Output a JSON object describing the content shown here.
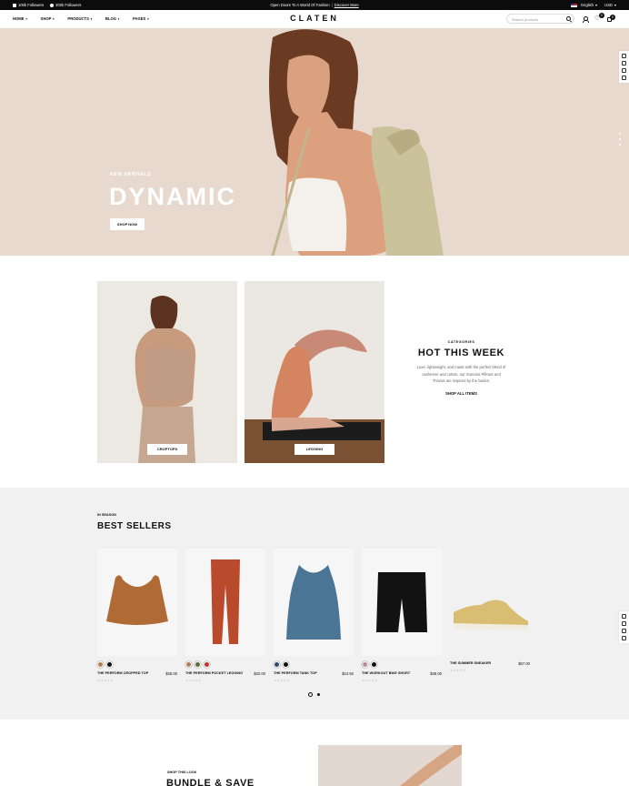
{
  "topbar": {
    "instagram_followers": "100k Followers",
    "facebook_followers": "300k Followers",
    "promo": "Open Doors To A World Of Fashion",
    "promo_link": "Discover More",
    "language": "English",
    "currency": "USD"
  },
  "header": {
    "logo": "CLATEN",
    "nav": [
      "HOME",
      "SHOP",
      "PRODUCTS",
      "BLOG",
      "PAGES"
    ],
    "search_placeholder": "Search products",
    "wishlist_count": "0",
    "cart_count": "0"
  },
  "hero": {
    "eyebrow": "NEW ARRIVALS",
    "title": "DYNAMIC",
    "button": "SHOP NOW"
  },
  "categories": {
    "cards": [
      "CROPTOPS",
      "LEGGING"
    ],
    "eyebrow": "CATEGORIES",
    "title": "HOT THIS WEEK",
    "description": "Luxe, lightweight, and made with the perfect blend of cashmere and cotton, our Sonoma Pillows and Throws are inspired by the basics.",
    "link": "SHOP ALL ITEMS"
  },
  "best_sellers": {
    "eyebrow": "IN SEASON",
    "title": "BEST SELLERS",
    "products": [
      {
        "name": "THE PERFORM CROPPED TOP",
        "price": "$35.00",
        "swatches": [
          "#b77a54",
          "#111111"
        ]
      },
      {
        "name": "THE PERFORM POCKET LEGGING",
        "price": "$32.00",
        "swatches": [
          "#b77a54",
          "#5d6a3a",
          "#c8302c"
        ]
      },
      {
        "name": "THE PERFORM TANK TOP",
        "price": "$24.50",
        "swatches": [
          "#2f4a6b",
          "#111111"
        ]
      },
      {
        "name": "THE WORKOUT BIKE SHORT",
        "price": "$38.00",
        "swatches": [
          "#b98a96",
          "#111111"
        ]
      },
      {
        "name": "THE SUMMER SNEAKER",
        "price": "$57.00",
        "swatches": []
      }
    ],
    "stars": "★★★★★"
  },
  "bundle": {
    "eyebrow": "SHOP THIS LOOK",
    "title": "BUNDLE & SAVE"
  },
  "colors": {
    "hero_bg": "#e8d9cf",
    "section_bg": "#f1f1f1",
    "topbar_bg": "#0c0c0c"
  }
}
